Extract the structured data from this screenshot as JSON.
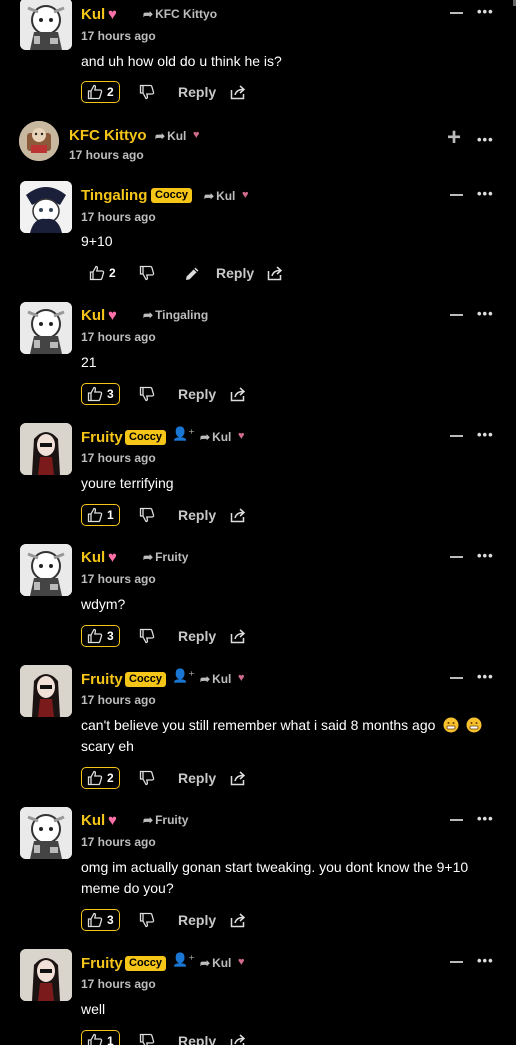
{
  "actions": {
    "reply_label": "Reply"
  },
  "comments": [
    {
      "user": "Kul",
      "badge": null,
      "reply_to": "KFC Kittyo",
      "time": "17 hours ago",
      "text": "and uh how old do u think he is?",
      "likes": "2",
      "avatar": "kul"
    },
    {
      "user": "KFC Kittyo",
      "badge": null,
      "reply_to": "Kul",
      "time": "17 hours ago",
      "text": "",
      "likes": "",
      "avatar": "kittyo"
    },
    {
      "user": "Tingaling",
      "badge": "Coccy",
      "reply_to": "Kul",
      "time": "17 hours ago",
      "text": "9+10",
      "likes": "2",
      "avatar": "tingaling"
    },
    {
      "user": "Kul",
      "badge": null,
      "reply_to": "Tingaling",
      "time": "17 hours ago",
      "text": "21",
      "likes": "3",
      "avatar": "kul"
    },
    {
      "user": "Fruity",
      "badge": "Coccy",
      "reply_to": "Kul",
      "time": "17 hours ago",
      "text": "youre terrifying",
      "likes": "1",
      "avatar": "fruity"
    },
    {
      "user": "Kul",
      "badge": null,
      "reply_to": "Fruity",
      "time": "17 hours ago",
      "text": "wdym?",
      "likes": "3",
      "avatar": "kul"
    },
    {
      "user": "Fruity",
      "badge": "Coccy",
      "reply_to": "Kul",
      "time": "17 hours ago",
      "text": "can't believe you still remember what i said 8 months ago",
      "text2": "scary eh",
      "likes": "2",
      "avatar": "fruity"
    },
    {
      "user": "Kul",
      "badge": null,
      "reply_to": "Fruity",
      "time": "17 hours ago",
      "text": "omg im actually gonan start tweaking. you dont know the 9+10",
      "text2": "meme do you?",
      "likes": "3",
      "avatar": "kul"
    },
    {
      "user": "Fruity",
      "badge": "Coccy",
      "reply_to": "Kul",
      "time": "17 hours ago",
      "text": "well",
      "likes": "1",
      "avatar": "fruity"
    }
  ]
}
